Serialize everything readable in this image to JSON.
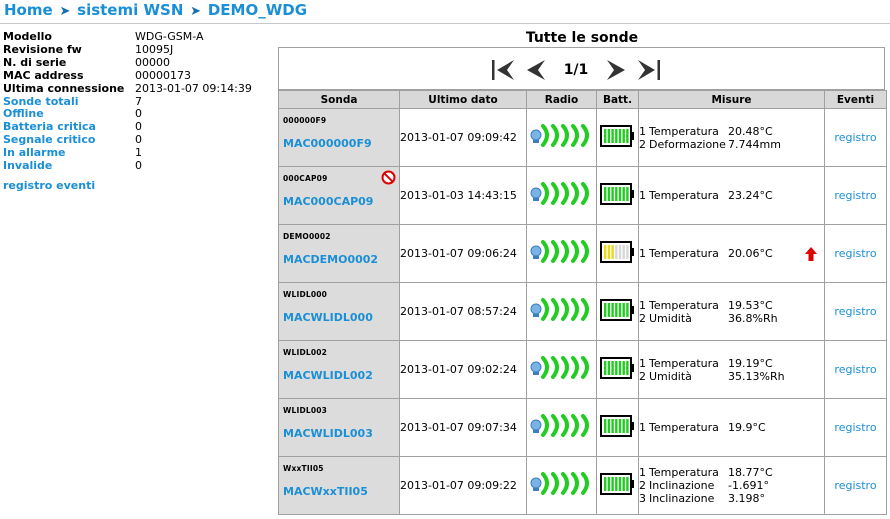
{
  "breadcrumb": [
    "Home",
    "sistemi WSN",
    "DEMO_WDG"
  ],
  "info": {
    "rows": [
      {
        "label": "Modello",
        "value": "WDG-GSM-A",
        "blue": false
      },
      {
        "label": "Revisione fw",
        "value": "10095J",
        "blue": false
      },
      {
        "label": "N. di serie",
        "value": "00000",
        "blue": false
      },
      {
        "label": "MAC address",
        "value": "00000173",
        "blue": false
      },
      {
        "label": "Ultima connessione",
        "value": "2013-01-07 09:14:39",
        "blue": false
      },
      {
        "label": "Sonde totali",
        "value": "7",
        "blue": true
      },
      {
        "label": "Offline",
        "value": "0",
        "blue": true
      },
      {
        "label": "Batteria critica",
        "value": "0",
        "blue": true
      },
      {
        "label": "Segnale critico",
        "value": "0",
        "blue": true
      },
      {
        "label": "In allarme",
        "value": "1",
        "blue": true
      },
      {
        "label": "Invalide",
        "value": "0",
        "blue": true
      }
    ],
    "events_link": "registro eventi"
  },
  "panel": {
    "title": "Tutte le sonde",
    "pager": "1/1",
    "headers": [
      "Sonda",
      "Ultimo dato",
      "Radio",
      "Batt.",
      "Misure",
      "Eventi"
    ]
  },
  "colors": {
    "link": "#1a8fd6",
    "battery_ok": "#22cc22",
    "battery_warn": "#e8d820",
    "radio": "#22cc22"
  },
  "sonde": [
    {
      "id": "000000F9",
      "mac": "MAC000000F9",
      "last": "2013-01-07 09:09:42",
      "battery": "full",
      "warn": false,
      "alarm": false,
      "misure": [
        {
          "n": "1",
          "label": "Temperatura",
          "value": "20.48°C"
        },
        {
          "n": "2",
          "label": "Deformazione",
          "value": "7.744mm"
        }
      ],
      "event": "registro"
    },
    {
      "id": "000CAP09",
      "mac": "MAC000CAP09",
      "last": "2013-01-03 14:43:15",
      "battery": "full",
      "warn": true,
      "alarm": false,
      "misure": [
        {
          "n": "1",
          "label": "Temperatura",
          "value": "23.24°C"
        }
      ],
      "event": "registro"
    },
    {
      "id": "DEMO0002",
      "mac": "MACDEMO0002",
      "last": "2013-01-07 09:06:24",
      "battery": "half",
      "warn": false,
      "alarm": true,
      "misure": [
        {
          "n": "1",
          "label": "Temperatura",
          "value": "20.06°C"
        }
      ],
      "event": "registro"
    },
    {
      "id": "WLIDL000",
      "mac": "MACWLIDL000",
      "last": "2013-01-07 08:57:24",
      "battery": "full",
      "warn": false,
      "alarm": false,
      "misure": [
        {
          "n": "1",
          "label": "Temperatura",
          "value": "19.53°C"
        },
        {
          "n": "2",
          "label": "Umidità",
          "value": "36.8%Rh"
        }
      ],
      "event": "registro"
    },
    {
      "id": "WLIDL002",
      "mac": "MACWLIDL002",
      "last": "2013-01-07 09:02:24",
      "battery": "full",
      "warn": false,
      "alarm": false,
      "misure": [
        {
          "n": "1",
          "label": "Temperatura",
          "value": "19.19°C"
        },
        {
          "n": "2",
          "label": "Umidità",
          "value": "35.13%Rh"
        }
      ],
      "event": "registro"
    },
    {
      "id": "WLIDL003",
      "mac": "MACWLIDL003",
      "last": "2013-01-07 09:07:34",
      "battery": "full",
      "warn": false,
      "alarm": false,
      "misure": [
        {
          "n": "1",
          "label": "Temperatura",
          "value": "19.9°C"
        }
      ],
      "event": "registro"
    },
    {
      "id": "WxxTII05",
      "mac": "MACWxxTII05",
      "last": "2013-01-07 09:09:22",
      "battery": "full",
      "warn": false,
      "alarm": false,
      "misure": [
        {
          "n": "1",
          "label": "Temperatura",
          "value": "18.77°C"
        },
        {
          "n": "2",
          "label": "Inclinazione",
          "value": "-1.691°"
        },
        {
          "n": "3",
          "label": "Inclinazione",
          "value": "3.198°"
        }
      ],
      "event": "registro"
    }
  ]
}
